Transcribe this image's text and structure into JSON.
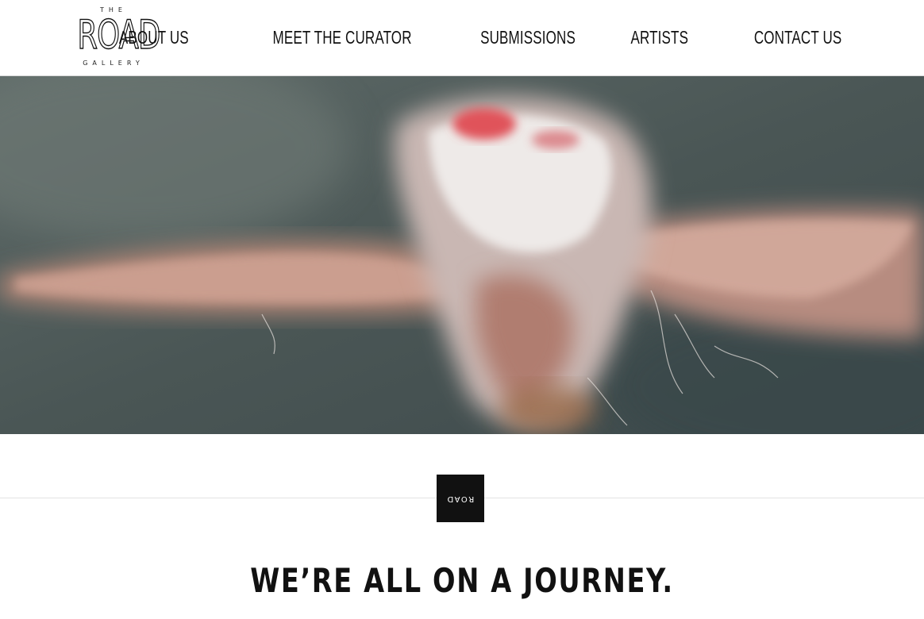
{
  "logo": {
    "top": "THE",
    "main": "ROAD",
    "bottom": "GALLERY"
  },
  "nav": {
    "items": [
      {
        "label": "ABOUT US"
      },
      {
        "label": "MEET THE CURATOR"
      },
      {
        "label": "SUBMISSIONS"
      },
      {
        "label": "ARTISTS"
      },
      {
        "label": "CONTACT US"
      }
    ]
  },
  "badge": {
    "label": "ROAD"
  },
  "tagline": {
    "text": "WE’RE ALL ON A JOURNEY."
  },
  "colors": {
    "text": "#111111",
    "background": "#ffffff",
    "badge": "#111111"
  }
}
